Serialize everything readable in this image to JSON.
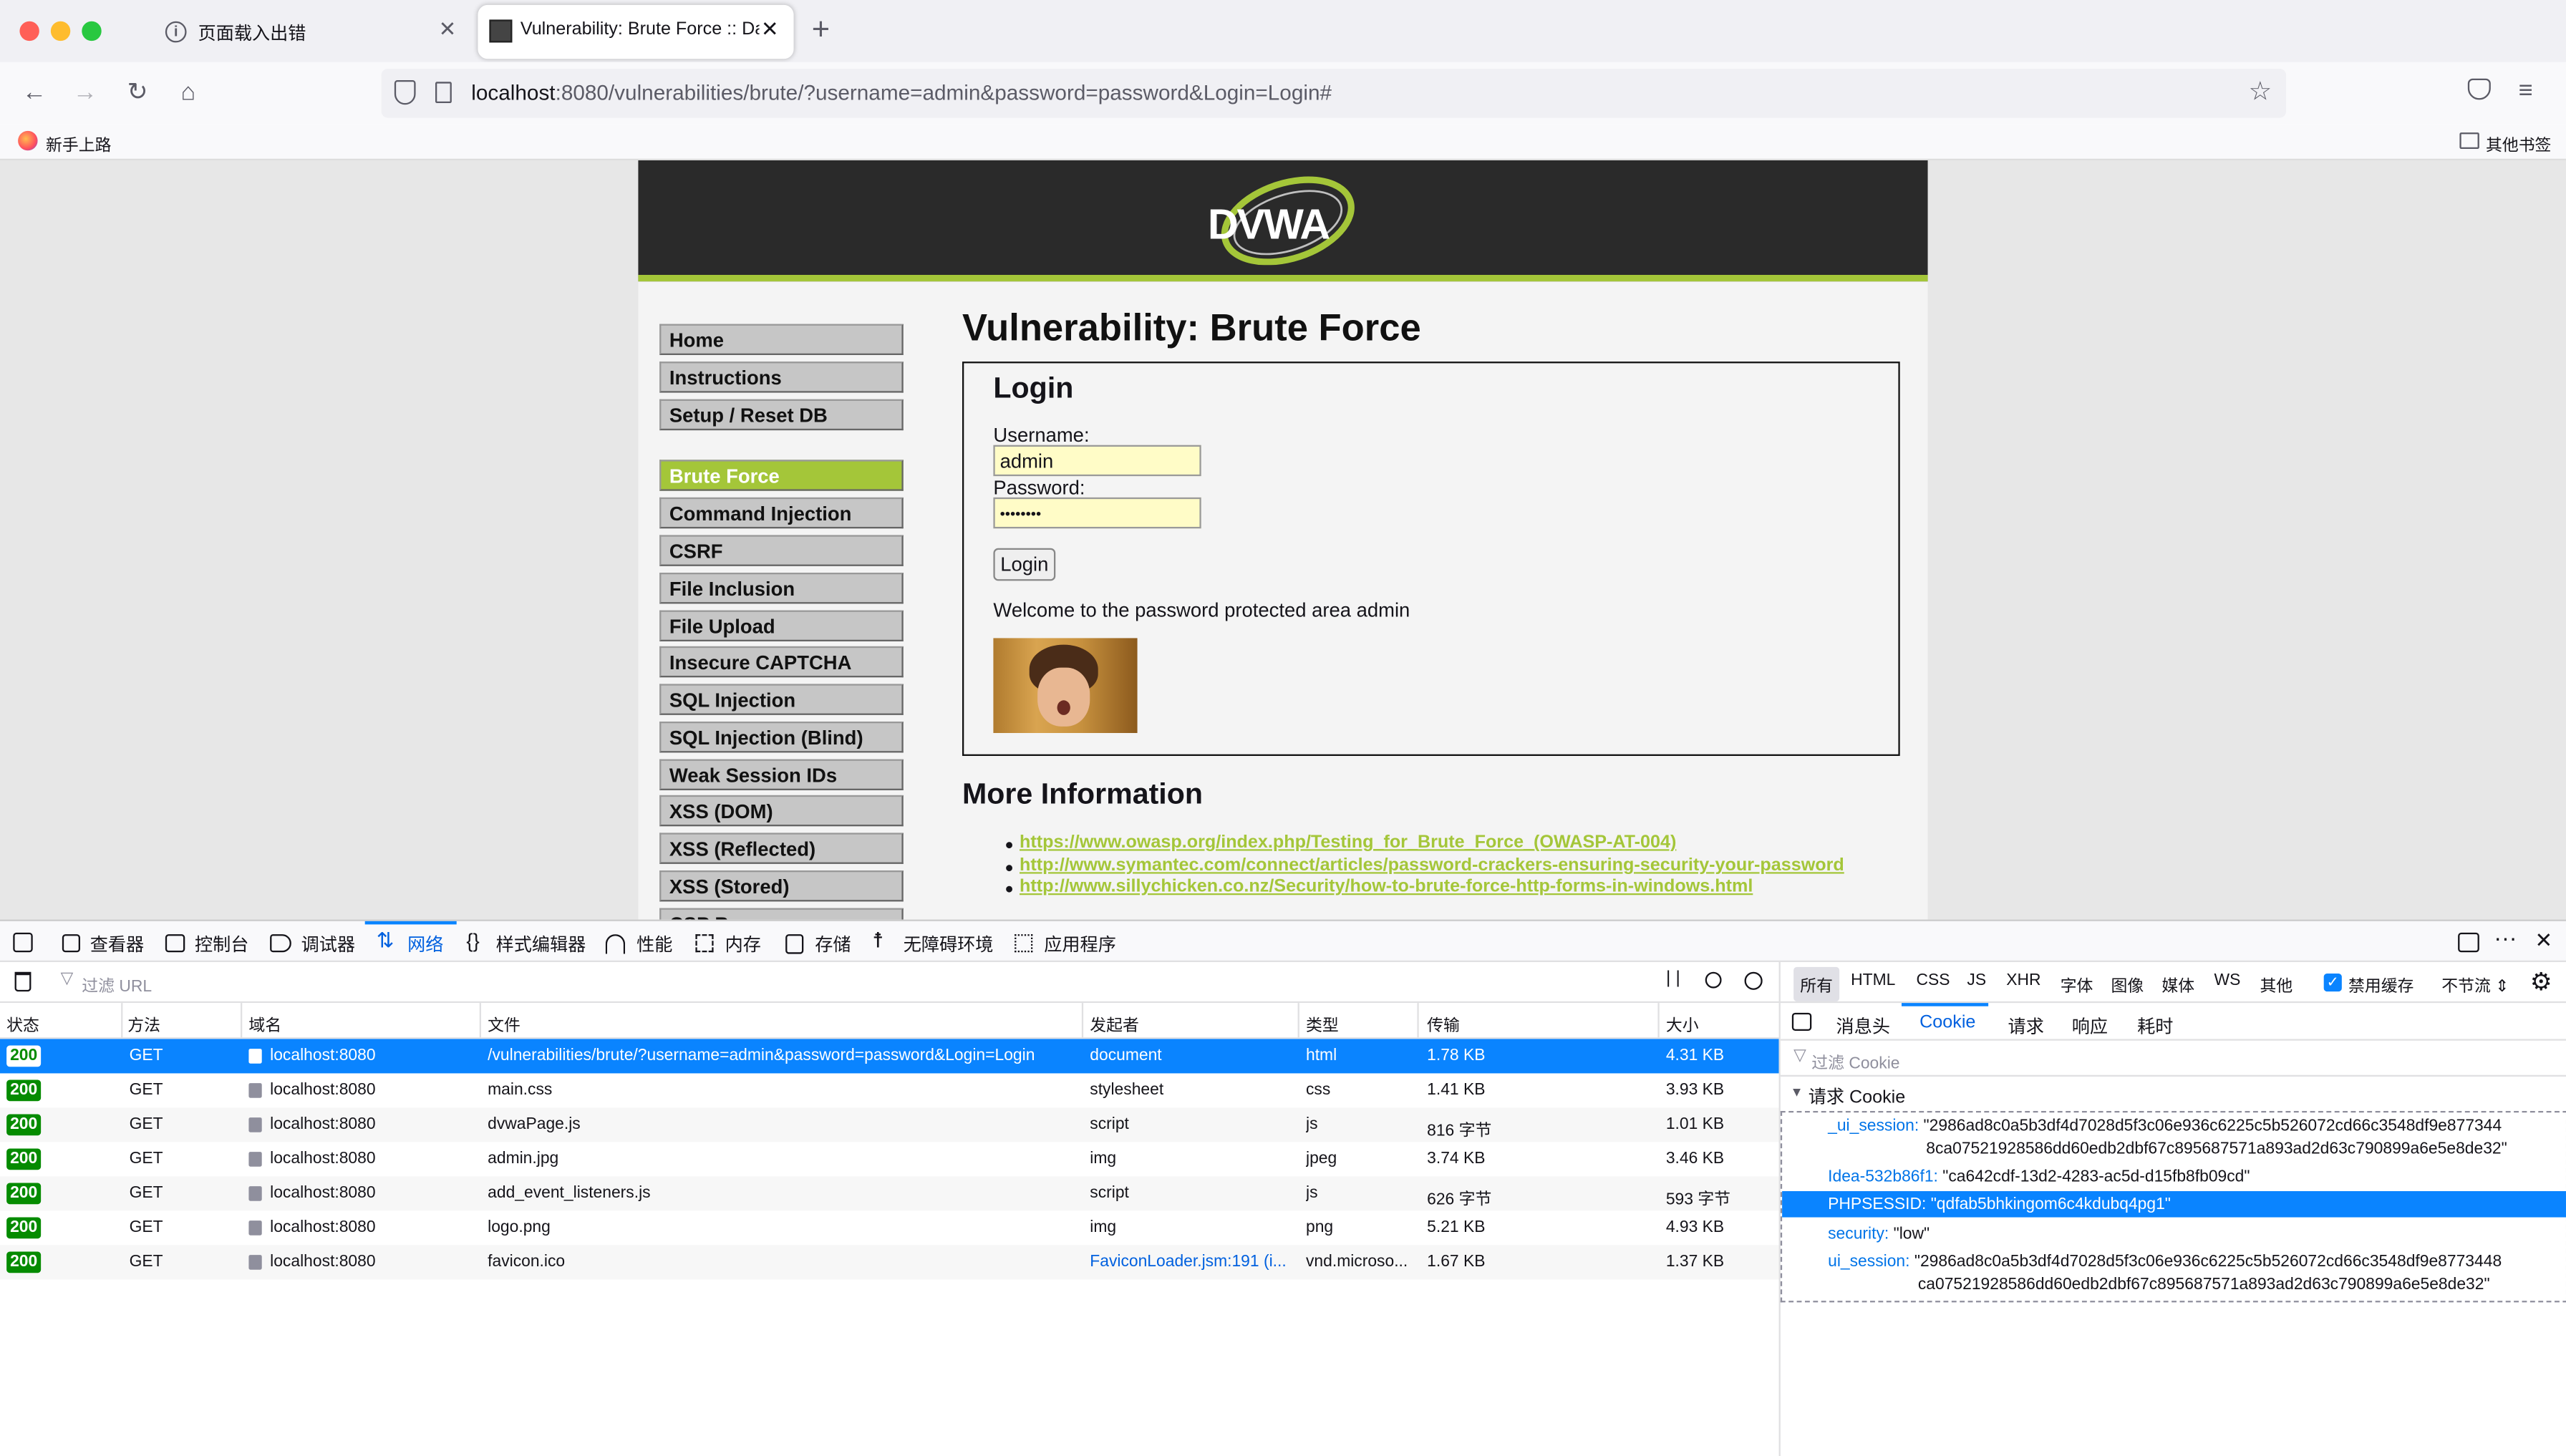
{
  "browser": {
    "tabs": [
      {
        "title": "页面载入出错",
        "icon": "info-icon"
      },
      {
        "title": "Vulnerability: Brute Force :: Dam",
        "icon": "dvwa-favicon"
      }
    ],
    "url_host": "localhost",
    "url_rest": ":8080/vulnerabilities/brute/?username=admin&password=password&Login=Login#",
    "bookmark_left": "新手上路",
    "bookmark_right": "其他书签"
  },
  "page": {
    "logo": "DVWA",
    "title": "Vulnerability: Brute Force",
    "menu": [
      "Home",
      "Instructions",
      "Setup / Reset DB",
      "Brute Force",
      "Command Injection",
      "CSRF",
      "File Inclusion",
      "File Upload",
      "Insecure CAPTCHA",
      "SQL Injection",
      "SQL Injection (Blind)",
      "Weak Session IDs",
      "XSS (DOM)",
      "XSS (Reflected)",
      "XSS (Stored)",
      "CSP B"
    ],
    "selected_menu": "Brute Force",
    "login_heading": "Login",
    "username_label": "Username:",
    "username_value": "admin",
    "password_label": "Password:",
    "password_value": "••••••••",
    "login_button": "Login",
    "welcome": "Welcome to the password protected area admin",
    "more_info": "More Information",
    "links": [
      "https://www.owasp.org/index.php/Testing_for_Brute_Force_(OWASP-AT-004)",
      "http://www.symantec.com/connect/articles/password-crackers-ensuring-security-your-password",
      "http://www.sillychicken.co.nz/Security/how-to-brute-force-http-forms-in-windows.html"
    ]
  },
  "devtools": {
    "tools": [
      "查看器",
      "控制台",
      "调试器",
      "网络",
      "样式编辑器",
      "性能",
      "内存",
      "存储",
      "无障碍环境",
      "应用程序"
    ],
    "active_tool": "网络",
    "filter_placeholder": "过滤 URL",
    "type_filters": [
      "所有",
      "HTML",
      "CSS",
      "JS",
      "XHR",
      "字体",
      "图像",
      "媒体",
      "WS",
      "其他"
    ],
    "disable_cache": "禁用缓存",
    "throttle": "不节流 ⇕",
    "columns": [
      "状态",
      "方法",
      "域名",
      "文件",
      "发起者",
      "类型",
      "传输",
      "大小"
    ],
    "requests": [
      {
        "status": "200",
        "method": "GET",
        "domain": "localhost:8080",
        "file": "/vulnerabilities/brute/?username=admin&password=password&Login=Login",
        "initiator": "document",
        "type": "html",
        "transfer": "1.78 KB",
        "size": "4.31 KB"
      },
      {
        "status": "200",
        "method": "GET",
        "domain": "localhost:8080",
        "file": "main.css",
        "initiator": "stylesheet",
        "type": "css",
        "transfer": "1.41 KB",
        "size": "3.93 KB"
      },
      {
        "status": "200",
        "method": "GET",
        "domain": "localhost:8080",
        "file": "dvwaPage.js",
        "initiator": "script",
        "type": "js",
        "transfer": "816 字节",
        "size": "1.01 KB"
      },
      {
        "status": "200",
        "method": "GET",
        "domain": "localhost:8080",
        "file": "admin.jpg",
        "initiator": "img",
        "type": "jpeg",
        "transfer": "3.74 KB",
        "size": "3.46 KB"
      },
      {
        "status": "200",
        "method": "GET",
        "domain": "localhost:8080",
        "file": "add_event_listeners.js",
        "initiator": "script",
        "type": "js",
        "transfer": "626 字节",
        "size": "593 字节"
      },
      {
        "status": "200",
        "method": "GET",
        "domain": "localhost:8080",
        "file": "logo.png",
        "initiator": "img",
        "type": "png",
        "transfer": "5.21 KB",
        "size": "4.93 KB"
      },
      {
        "status": "200",
        "method": "GET",
        "domain": "localhost:8080",
        "file": "favicon.ico",
        "initiator": "FaviconLoader.jsm:191 (i...",
        "type": "vnd.microso...",
        "transfer": "1.67 KB",
        "size": "1.37 KB"
      }
    ],
    "side_tabs": [
      "消息头",
      "Cookie",
      "请求",
      "响应",
      "耗时"
    ],
    "active_side_tab": "Cookie",
    "cookie_filter": "过滤 Cookie",
    "cookie_section": "请求 Cookie",
    "cookies": [
      {
        "key": "_ui_session:",
        "value": "\"2986ad8c0a5b3df4d7028d5f3c06e936c6225c5b526072cd66c3548df9e877344",
        "value2": "8ca07521928586dd60edb2dbf67c895687571a893ad2d63c790899a6e5e8de32\""
      },
      {
        "key": "Idea-532b86f1:",
        "value": "\"ca642cdf-13d2-4283-ac5d-d15fb8fb09cd\"",
        "value2": ""
      },
      {
        "key": "PHPSESSID:",
        "value": "\"qdfab5bhkingom6c4kdubq4pg1\"",
        "value2": ""
      },
      {
        "key": "security:",
        "value": "\"low\"",
        "value2": ""
      },
      {
        "key": "ui_session:",
        "value": "\"2986ad8c0a5b3df4d7028d5f3c06e936c6225c5b526072cd66c3548df9e8773448",
        "value2": "ca07521928586dd60edb2dbf67c895687571a893ad2d63c790899a6e5e8de32\""
      }
    ]
  }
}
